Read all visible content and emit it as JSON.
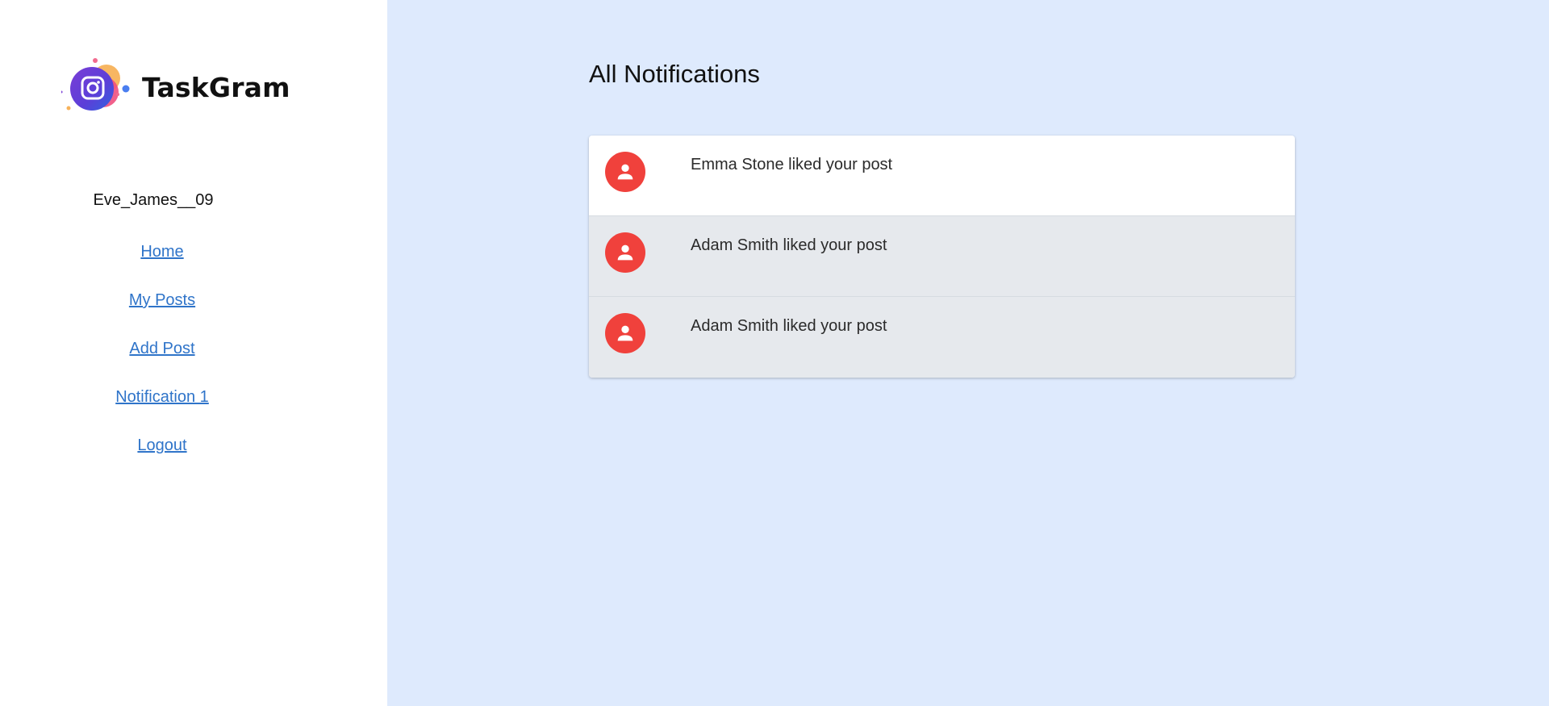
{
  "app": {
    "name": "TaskGram",
    "colors": {
      "sidebar_bg": "#ffffff",
      "main_bg": "#deeafd",
      "link": "#2f74c9",
      "avatar": "#f0413c",
      "unread_bg": "#ffffff",
      "read_bg": "#e6e9ed"
    }
  },
  "sidebar": {
    "logo_icon": "instagram-camera-icon",
    "username": "Eve_James__09",
    "nav": [
      {
        "label": "Home"
      },
      {
        "label": "My Posts"
      },
      {
        "label": "Add Post"
      },
      {
        "label": "Notification 1"
      },
      {
        "label": "Logout"
      }
    ]
  },
  "main": {
    "title": "All Notifications",
    "notifications": [
      {
        "text": "Emma Stone liked your post",
        "read": false,
        "icon": "person-icon"
      },
      {
        "text": "Adam Smith liked your post",
        "read": true,
        "icon": "person-icon"
      },
      {
        "text": "Adam Smith liked your post",
        "read": true,
        "icon": "person-icon"
      }
    ]
  }
}
